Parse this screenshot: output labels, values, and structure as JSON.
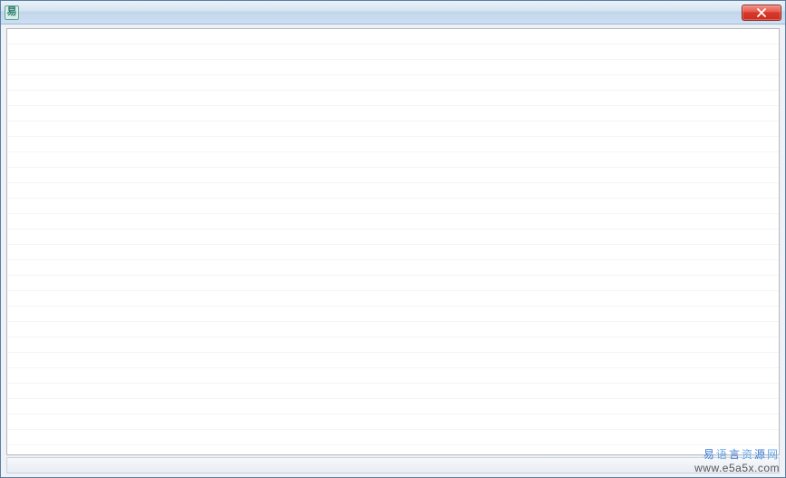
{
  "window": {
    "title": "",
    "icon_glyph": "易"
  },
  "watermark": {
    "line1_chars": [
      "易",
      "语",
      "言",
      "资",
      "源",
      "网"
    ],
    "line2": "www.e5a5x.com"
  }
}
